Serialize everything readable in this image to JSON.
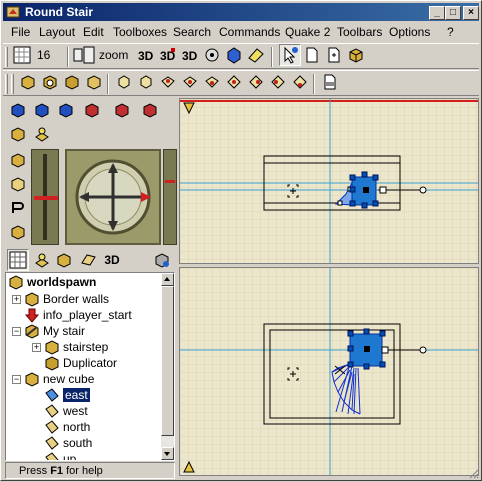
{
  "window": {
    "title": "Round Stair",
    "min_label": "_",
    "max_label": "□",
    "close_label": "×"
  },
  "menu": [
    "File",
    "Layout",
    "Edit",
    "Toolboxes",
    "Search",
    "Commands",
    "Quake 2",
    "Toolbars",
    "Options",
    "?"
  ],
  "toolbar": {
    "grid_size": "16",
    "zoom_label": "zoom"
  },
  "left_tools": {
    "view_3d_label": "3D"
  },
  "tree": {
    "items": [
      {
        "label": "worldspawn"
      },
      {
        "label": "Border walls"
      },
      {
        "label": "info_player_start"
      },
      {
        "label": "My stair"
      },
      {
        "label": "stairstep"
      },
      {
        "label": "Duplicator"
      },
      {
        "label": "new cube"
      },
      {
        "label": "east"
      },
      {
        "label": "west"
      },
      {
        "label": "north"
      },
      {
        "label": "south"
      },
      {
        "label": "up"
      }
    ]
  },
  "status": {
    "pre": "Press ",
    "key": "F1",
    "post": " for help"
  },
  "colors": {
    "title_start": "#0a246a",
    "title_end": "#3a6ea5",
    "map_bg": "#ece6cc",
    "grid_blue": "#3aa0d0",
    "brush_blue": "#1e78d0",
    "selection": "#0a246a"
  }
}
